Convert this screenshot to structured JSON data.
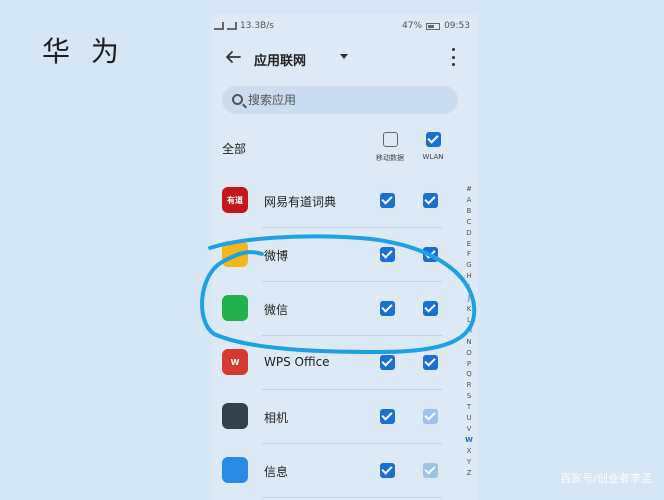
{
  "overlay": {
    "brand_label": "华 为",
    "watermark": "百家号/创业者李孟"
  },
  "status_bar": {
    "speed": "13.3B/s",
    "battery": "47%",
    "time": "09:53"
  },
  "toolbar": {
    "title": "应用联网",
    "back_icon": "arrow-left-icon",
    "more_icon": "more-vertical-icon"
  },
  "search": {
    "placeholder": "搜索应用"
  },
  "header": {
    "all_label": "全部",
    "mobile_data_label": "移动数据",
    "wlan_label": "WLAN",
    "mobile_data_all_checked": false,
    "wlan_all_checked": true
  },
  "apps": [
    {
      "name": "网易有道词典",
      "icon": "youdao-icon",
      "icon_text": "有道",
      "color": "#c4171b",
      "mobile": true,
      "wlan": true
    },
    {
      "name": "微博",
      "icon": "weibo-icon",
      "icon_text": "",
      "color": "#f3b71b",
      "mobile": true,
      "wlan": true
    },
    {
      "name": "微信",
      "icon": "wechat-icon",
      "icon_text": "",
      "color": "#22b14c",
      "mobile": true,
      "wlan": true
    },
    {
      "name": "WPS Office",
      "icon": "wps-icon",
      "icon_text": "W",
      "color": "#d23a32",
      "mobile": true,
      "wlan": true
    },
    {
      "name": "相机",
      "icon": "camera-icon",
      "icon_text": "",
      "color": "#33414f",
      "mobile": true,
      "wlan": "disabled"
    },
    {
      "name": "信息",
      "icon": "messages-icon",
      "icon_text": "",
      "color": "#2a8be6",
      "mobile": true,
      "wlan": "disabled"
    }
  ],
  "index_letters": [
    "#",
    "A",
    "B",
    "C",
    "D",
    "E",
    "F",
    "G",
    "H",
    "I",
    "J",
    "K",
    "L",
    "M",
    "N",
    "O",
    "P",
    "Q",
    "R",
    "S",
    "T",
    "U",
    "V",
    "W",
    "X",
    "Y",
    "Z"
  ],
  "active_index_letter": "W",
  "colors": {
    "accent": "#1a6fd6",
    "annotation": "#1ea0e6"
  }
}
